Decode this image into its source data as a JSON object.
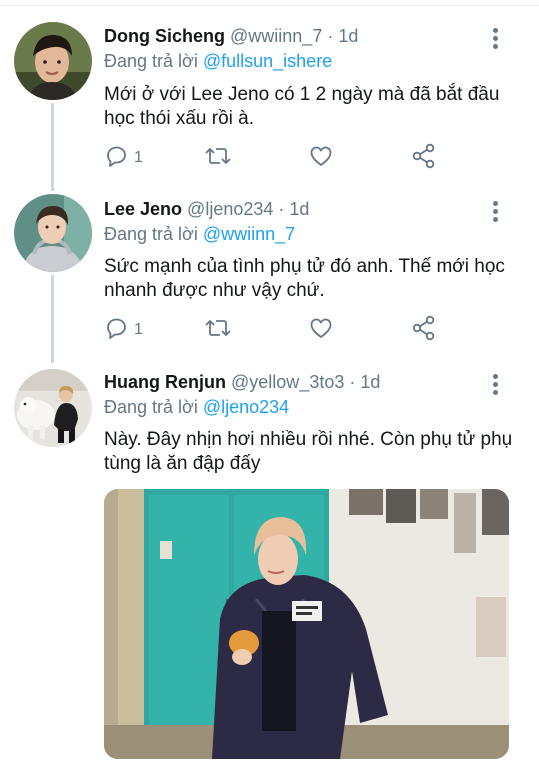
{
  "tweets": [
    {
      "name": "Dong Sicheng",
      "handle": "@wwiinn_7",
      "time": "1d",
      "reply_prefix": "Đang trả lời",
      "reply_to": "@fullsun_ishere",
      "text": "Mới ở với Lee Jeno có 1 2 ngày mà đã bắt đầu học thói xấu rồi à.",
      "reply_count": "1"
    },
    {
      "name": "Lee Jeno",
      "handle": "@ljeno234",
      "time": "1d",
      "reply_prefix": "Đang trả lời",
      "reply_to": "@wwiinn_7",
      "text": "Sức mạnh của tình phụ tử đó anh. Thế mới học nhanh được như vậy chứ.",
      "reply_count": "1"
    },
    {
      "name": "Huang Renjun",
      "handle": "@yellow_3to3",
      "time": "1d",
      "reply_prefix": "Đang trả lời",
      "reply_to": "@ljeno234",
      "text": "Này. Đây nhịn hơi nhiều rồi nhé. Còn phụ tử phụ tùng là ăn đập đấy",
      "reply_count": ""
    }
  ],
  "separator": "·",
  "icons": {
    "reply": "reply-icon",
    "retweet": "retweet-icon",
    "like": "like-icon",
    "share": "share-icon",
    "more": "more-vertical-icon"
  },
  "colors": {
    "link": "#1da1f2",
    "secondary": "#657786",
    "thread_line": "#ccd6dd"
  }
}
